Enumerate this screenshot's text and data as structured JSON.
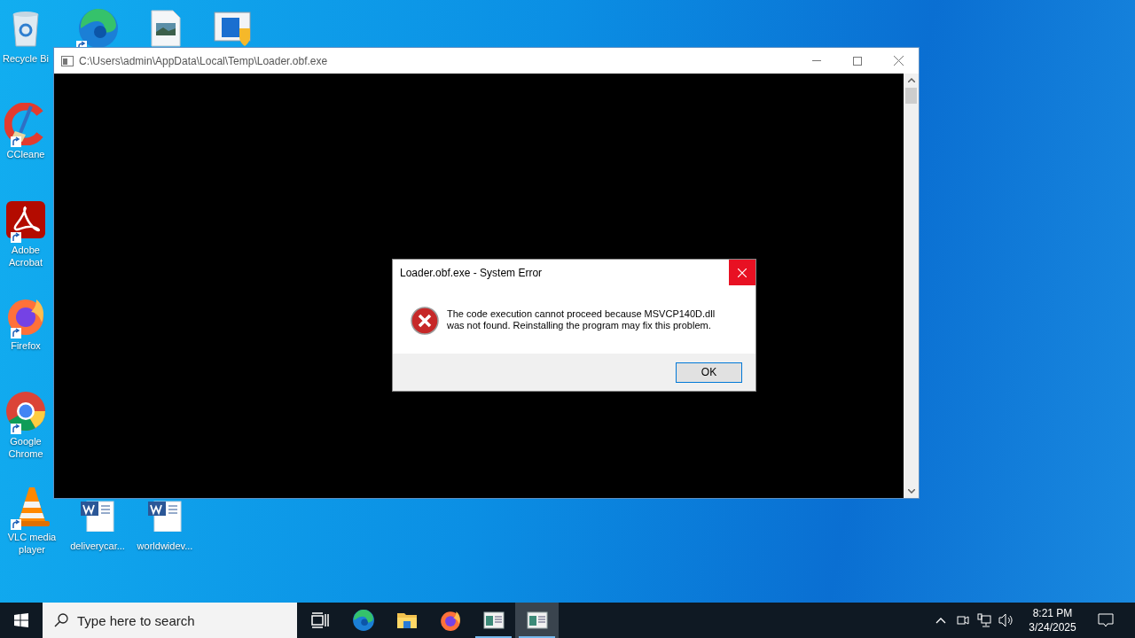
{
  "desktop_icons": [
    {
      "kind": "recycle_bin",
      "label": "Recycle Bi",
      "shortcut": false
    },
    {
      "kind": "edge",
      "shortcut": true
    },
    {
      "kind": "image_file",
      "shortcut": false
    },
    {
      "kind": "security_app",
      "shortcut": false
    },
    {
      "kind": "ccleaner",
      "label": "CCleane",
      "shortcut": true
    },
    {
      "kind": "acrobat",
      "label": "Adobe Acrobat",
      "shortcut": true
    },
    {
      "kind": "firefox",
      "label": "Firefox",
      "shortcut": true
    },
    {
      "kind": "chrome",
      "label": "Google Chrome",
      "shortcut": true
    },
    {
      "kind": "vlc",
      "label": "VLC media player",
      "shortcut": true
    },
    {
      "kind": "word_doc",
      "label": "deliverycar...",
      "shortcut": false
    },
    {
      "kind": "word_doc",
      "label": "worldwidev...",
      "shortcut": false
    }
  ],
  "console_window": {
    "title": "C:\\Users\\admin\\AppData\\Local\\Temp\\Loader.obf.exe"
  },
  "error_dialog": {
    "title": "Loader.obf.exe - System Error",
    "message": "The code execution cannot proceed because MSVCP140D.dll was not found. Reinstalling the program may fix this problem.",
    "button": "OK"
  },
  "taskbar": {
    "search": {
      "placeholder": "Type here to search"
    },
    "items": [
      {
        "kind": "task_view",
        "running": false,
        "selected": false
      },
      {
        "kind": "edge",
        "running": false,
        "selected": false
      },
      {
        "kind": "explorer",
        "running": false,
        "selected": false
      },
      {
        "kind": "firefox",
        "running": false,
        "selected": false
      },
      {
        "kind": "console",
        "running": true,
        "selected": false
      },
      {
        "kind": "console",
        "running": true,
        "selected": true
      }
    ],
    "clock": {
      "time": "8:21 PM",
      "date": "3/24/2025"
    }
  }
}
